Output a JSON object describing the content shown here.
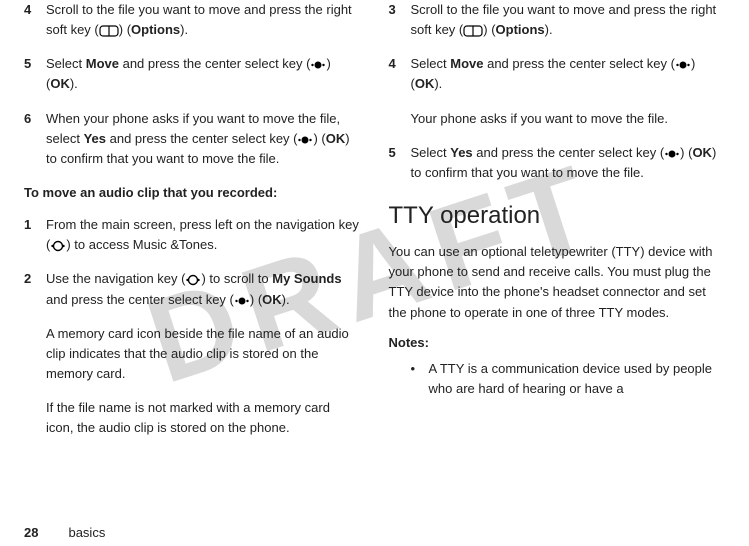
{
  "watermark": "DRAFT",
  "left": {
    "step4": {
      "num": "4",
      "pre": "Scroll to the file you want to move and press the right soft key (",
      "post": ") (",
      "opt": "Options",
      "close": ")."
    },
    "step5": {
      "num": "5",
      "pre": "Select ",
      "move": "Move",
      "mid": " and press the center select key (",
      "post": ") (",
      "ok": "OK",
      "close": ")."
    },
    "step6": {
      "num": "6",
      "pre": "When your phone asks if you want to move the file, select ",
      "yes": "Yes",
      "mid": " and press the center select key (",
      "post": ") (",
      "ok": "OK",
      "close": ") to confirm that you want to move the file."
    },
    "subhead": "To move an audio clip that you recorded:",
    "step1": {
      "num": "1",
      "pre": "From the main screen, press left on the navigation key (",
      "post": ") to access Music &Tones."
    },
    "step2": {
      "num": "2",
      "pre": "Use the navigation key (",
      "mid": ") to scroll to ",
      "my": "My Sounds",
      "mid2": " and press the center select key (",
      "post": ") (",
      "ok": "OK",
      "close": ")."
    },
    "para1": "A memory card icon beside the file name of an audio clip indicates that the audio clip is stored on the memory card.",
    "para2": "If the file name is not marked with a memory card icon, the audio clip is stored on the phone."
  },
  "right": {
    "step3": {
      "num": "3",
      "pre": "Scroll to the file you want to move and press the right soft key (",
      "post": ") (",
      "opt": "Options",
      "close": ")."
    },
    "step4": {
      "num": "4",
      "pre": "Select ",
      "move": "Move",
      "mid": " and press the center select key (",
      "post": ") (",
      "ok": "OK",
      "close": ")."
    },
    "para1": "Your phone asks if you want to move the file.",
    "step5": {
      "num": "5",
      "pre": "Select ",
      "yes": "Yes",
      "mid": " and press the center select key (",
      "post": ") (",
      "ok": "OK",
      "close": ") to confirm that you want to move the file."
    },
    "heading": "TTY operation",
    "body": "You can use an optional teletypewriter (TTY) device with your phone to send and receive calls. You must plug the TTY device into the phone's headset connector and set the phone to operate in one of three TTY modes.",
    "notes": "Notes:",
    "bullet1": "A TTY is a communication device used by people who are hard of hearing or have a"
  },
  "footer": {
    "page": "28",
    "section": "basics"
  },
  "bullet_char": "•"
}
